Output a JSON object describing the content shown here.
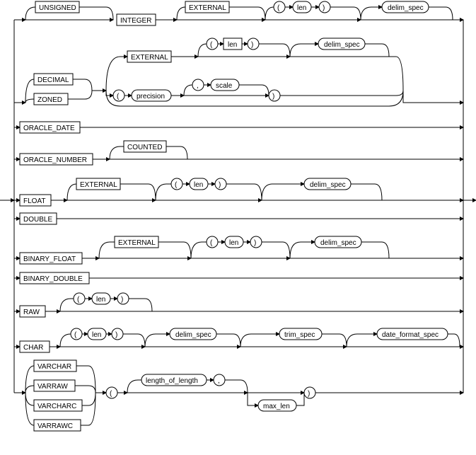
{
  "tokens": {
    "unsigned": "UNSIGNED",
    "integer": "INTEGER",
    "external": "EXTERNAL",
    "decimal": "DECIMAL",
    "zoned": "ZONED",
    "oracle_date": "ORACLE_DATE",
    "oracle_number": "ORACLE_NUMBER",
    "counted": "COUNTED",
    "float": "FLOAT",
    "double": "DOUBLE",
    "binary_float": "BINARY_FLOAT",
    "binary_double": "BINARY_DOUBLE",
    "raw": "RAW",
    "char": "CHAR",
    "varchar": "VARCHAR",
    "varraw": "VARRAW",
    "varcharc": "VARCHARC",
    "varrawc": "VARRAWC",
    "len": "len",
    "precision": "precision",
    "scale": "scale",
    "delim_spec": "delim_spec",
    "trim_spec": "trim_spec",
    "date_format_spec": "date_format_spec",
    "length_of_length": "length_of_length",
    "max_len": "max_len",
    "lparen": "(",
    "rparen": ")",
    "comma": ","
  }
}
